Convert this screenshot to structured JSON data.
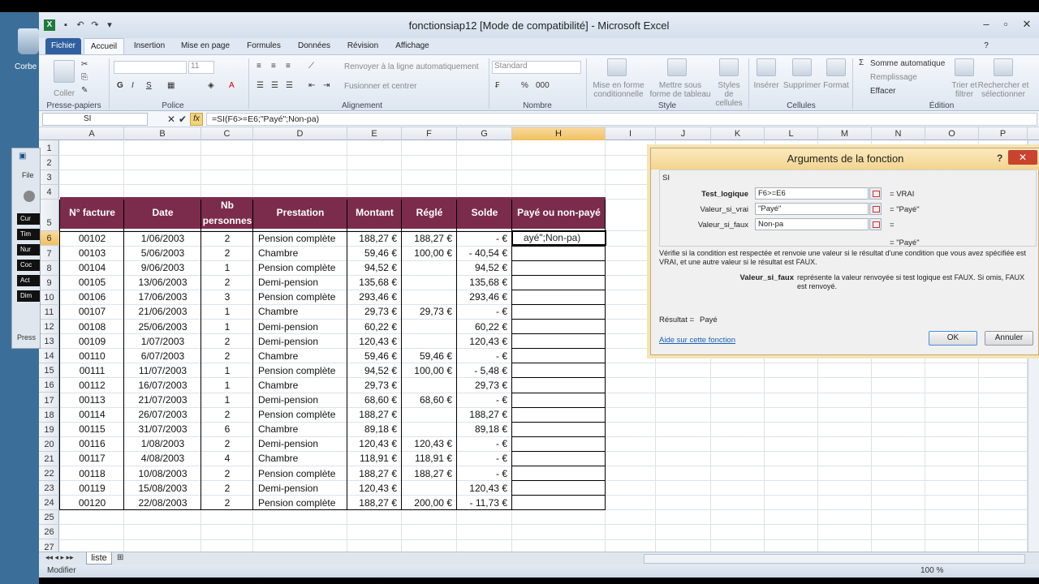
{
  "window": {
    "title": "fonctionsiap12  [Mode de compatibilité]  -  Microsoft Excel"
  },
  "desktop": {
    "recycle_label": "Corbe",
    "panel_items": [
      "Cur",
      "Tim",
      "Nur",
      "Coc",
      "Act",
      "Dim"
    ],
    "panel_file": "File",
    "panel_press": "Press"
  },
  "ribbon": {
    "tabs": [
      "Fichier",
      "Accueil",
      "Insertion",
      "Mise en page",
      "Formules",
      "Données",
      "Révision",
      "Affichage"
    ],
    "groups": [
      "Presse-papiers",
      "Police",
      "Alignement",
      "Nombre",
      "Style",
      "Cellules",
      "Édition"
    ],
    "coller": "Coller",
    "font_size": "11",
    "wrap_text": "Renvoyer à la ligne automatiquement",
    "merge": "Fusionner et centrer",
    "number_format": "Standard",
    "styles": [
      "Mise en forme conditionnelle",
      "Mettre sous forme de tableau",
      "Styles de cellules"
    ],
    "cells": [
      "Insérer",
      "Supprimer",
      "Format"
    ],
    "edition": [
      "Somme automatique",
      "Remplissage",
      "Effacer",
      "Trier et filtrer",
      "Rechercher et sélectionner"
    ],
    "bold": "G",
    "italic": "I",
    "underline": "S"
  },
  "formula_bar": {
    "name_box": "SI",
    "formula": "=SI(F6>=E6;\"Payé\";Non-pa)",
    "fx": "fx"
  },
  "columns": [
    "A",
    "B",
    "C",
    "D",
    "E",
    "F",
    "G",
    "H",
    "I",
    "J",
    "K",
    "L",
    "M",
    "N",
    "O",
    "P"
  ],
  "rows": [
    "1",
    "2",
    "3",
    "4",
    "5",
    "6",
    "7",
    "8",
    "9",
    "10",
    "11",
    "12",
    "13",
    "14",
    "15",
    "16",
    "17",
    "18",
    "19",
    "20",
    "21",
    "22",
    "23",
    "24",
    "25",
    "26",
    "27"
  ],
  "table": {
    "headers": [
      "N° facture",
      "Date",
      "Nb personnes",
      "Prestation",
      "Montant",
      "Réglé",
      "Solde",
      "Payé ou non-payé"
    ],
    "rows": [
      [
        "00102",
        "1/06/2003",
        "2",
        "Pension complète",
        "188,27 €",
        "188,27 €",
        "-     €"
      ],
      [
        "00103",
        "5/06/2003",
        "2",
        "Chambre",
        "59,46 €",
        "100,00 €",
        "-   40,54 €"
      ],
      [
        "00104",
        "9/06/2003",
        "1",
        "Pension complète",
        "94,52 €",
        "",
        "94,52 €"
      ],
      [
        "00105",
        "13/06/2003",
        "2",
        "Demi-pension",
        "135,68 €",
        "",
        "135,68 €"
      ],
      [
        "00106",
        "17/06/2003",
        "3",
        "Pension complète",
        "293,46 €",
        "",
        "293,46 €"
      ],
      [
        "00107",
        "21/06/2003",
        "1",
        "Chambre",
        "29,73 €",
        "29,73 €",
        "-     €"
      ],
      [
        "00108",
        "25/06/2003",
        "1",
        "Demi-pension",
        "60,22 €",
        "",
        "60,22 €"
      ],
      [
        "00109",
        "1/07/2003",
        "2",
        "Demi-pension",
        "120,43 €",
        "",
        "120,43 €"
      ],
      [
        "00110",
        "6/07/2003",
        "2",
        "Chambre",
        "59,46 €",
        "59,46 €",
        "-     €"
      ],
      [
        "00111",
        "11/07/2003",
        "1",
        "Pension complète",
        "94,52 €",
        "100,00 €",
        "-     5,48 €"
      ],
      [
        "00112",
        "16/07/2003",
        "1",
        "Chambre",
        "29,73 €",
        "",
        "29,73 €"
      ],
      [
        "00113",
        "21/07/2003",
        "1",
        "Demi-pension",
        "68,60 €",
        "68,60 €",
        "-     €"
      ],
      [
        "00114",
        "26/07/2003",
        "2",
        "Pension complète",
        "188,27 €",
        "",
        "188,27 €"
      ],
      [
        "00115",
        "31/07/2003",
        "6",
        "Chambre",
        "89,18 €",
        "",
        "89,18 €"
      ],
      [
        "00116",
        "1/08/2003",
        "2",
        "Demi-pension",
        "120,43 €",
        "120,43 €",
        "-     €"
      ],
      [
        "00117",
        "4/08/2003",
        "4",
        "Chambre",
        "118,91 €",
        "118,91 €",
        "-     €"
      ],
      [
        "00118",
        "10/08/2003",
        "2",
        "Pension complète",
        "188,27 €",
        "188,27 €",
        "-     €"
      ],
      [
        "00119",
        "15/08/2003",
        "2",
        "Demi-pension",
        "120,43 €",
        "",
        "120,43 €"
      ],
      [
        "00120",
        "22/08/2003",
        "2",
        "Pension complète",
        "188,27 €",
        "200,00 €",
        "-   11,73 €"
      ]
    ],
    "active_cell_text": "ayé\";Non-pa)"
  },
  "sheet": {
    "tab": "liste",
    "status": "Modifier",
    "zoom": "100 %"
  },
  "dialog": {
    "title": "Arguments de la fonction",
    "help": "?",
    "close": "✕",
    "func": "SI",
    "args": [
      {
        "label": "Test_logique",
        "value": "F6>=E6",
        "result": "VRAI"
      },
      {
        "label": "Valeur_si_vrai",
        "value": "\"Payé\"",
        "result": "\"Payé\""
      },
      {
        "label": "Valeur_si_faux",
        "value": "Non-pa",
        "result": ""
      }
    ],
    "formula_result": "\"Payé\"",
    "description": "Vérifie si la condition est respectée et renvoie une valeur si le résultat d'une condition que vous avez spécifiée est VRAI, et une autre valeur si le résultat est FAUX.",
    "arg_name": "Valeur_si_faux",
    "arg_desc": "représente la valeur renvoyée si test logique est FAUX. Si omis, FAUX est renvoyé.",
    "result_label": "Résultat =",
    "result_value": "Payé",
    "help_link": "Aide sur cette fonction",
    "ok": "OK",
    "cancel": "Annuler"
  }
}
